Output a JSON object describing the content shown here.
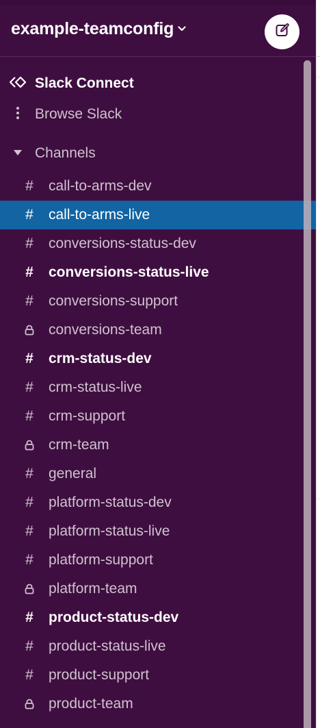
{
  "workspace": {
    "name": "example-teamconfig",
    "chevron_icon": "chevron-down-icon",
    "compose_icon": "compose-icon"
  },
  "nav": {
    "slack_connect": "Slack Connect",
    "browse_slack": "Browse Slack",
    "channels_header": "Channels"
  },
  "colors": {
    "sidebar_bg": "#3f0e40",
    "active_bg": "#1264a3",
    "text_muted": "#cfc3cf",
    "text_strong": "#ffffff"
  },
  "channels": [
    {
      "name": "call-to-arms-dev",
      "icon": "hash-icon",
      "state": "normal"
    },
    {
      "name": "call-to-arms-live",
      "icon": "hash-icon",
      "state": "active"
    },
    {
      "name": "conversions-status-dev",
      "icon": "hash-icon",
      "state": "normal"
    },
    {
      "name": "conversions-status-live",
      "icon": "hash-icon",
      "state": "unread"
    },
    {
      "name": "conversions-support",
      "icon": "hash-icon",
      "state": "normal"
    },
    {
      "name": "conversions-team",
      "icon": "lock-icon",
      "state": "normal"
    },
    {
      "name": "crm-status-dev",
      "icon": "hash-icon",
      "state": "unread"
    },
    {
      "name": "crm-status-live",
      "icon": "hash-icon",
      "state": "normal"
    },
    {
      "name": "crm-support",
      "icon": "hash-icon",
      "state": "normal"
    },
    {
      "name": "crm-team",
      "icon": "lock-icon",
      "state": "normal"
    },
    {
      "name": "general",
      "icon": "hash-icon",
      "state": "normal"
    },
    {
      "name": "platform-status-dev",
      "icon": "hash-icon",
      "state": "normal"
    },
    {
      "name": "platform-status-live",
      "icon": "hash-icon",
      "state": "normal"
    },
    {
      "name": "platform-support",
      "icon": "hash-icon",
      "state": "normal"
    },
    {
      "name": "platform-team",
      "icon": "lock-icon",
      "state": "normal"
    },
    {
      "name": "product-status-dev",
      "icon": "hash-icon",
      "state": "unread"
    },
    {
      "name": "product-status-live",
      "icon": "hash-icon",
      "state": "normal"
    },
    {
      "name": "product-support",
      "icon": "hash-icon",
      "state": "normal"
    },
    {
      "name": "product-team",
      "icon": "lock-icon",
      "state": "normal"
    }
  ]
}
